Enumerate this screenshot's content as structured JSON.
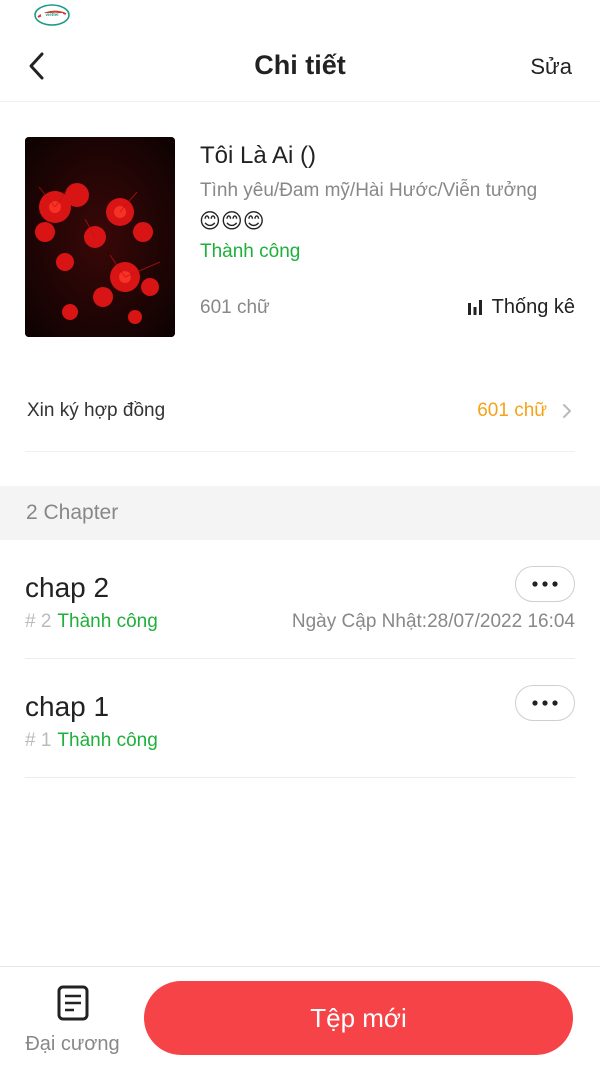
{
  "status_bar": {
    "carrier_logo_icon": "viettel-logo"
  },
  "header": {
    "title": "Chi tiết",
    "edit_label": "Sửa",
    "back_icon": "chevron-left-icon"
  },
  "book": {
    "title": "Tôi Là Ai ()",
    "genres": "Tình yêu/Đam mỹ/Hài Hước/Viễn tưởng",
    "rating": "😊😊😊",
    "status": "Thành công",
    "word_count": "601 chữ",
    "stats_label": "Thống kê",
    "cover_icon": "red-spider-lily-cover-image"
  },
  "contract": {
    "label": "Xin ký hợp đồng",
    "value": "601 chữ"
  },
  "chapters_section": {
    "count_label": "2 Chapter"
  },
  "chapters": [
    {
      "title": "chap 2",
      "number": "# 2",
      "status": "Thành công",
      "updated": "Ngày Cập Nhật:28/07/2022 16:04"
    },
    {
      "title": "chap 1",
      "number": "# 1",
      "status": "Thành công"
    }
  ],
  "bottom_bar": {
    "outline_label": "Đại cương",
    "new_file_label": "Tệp mới"
  },
  "colors": {
    "accent_red": "#f64347",
    "success_green": "#1fb03b",
    "highlight_orange": "#f5a31a"
  }
}
